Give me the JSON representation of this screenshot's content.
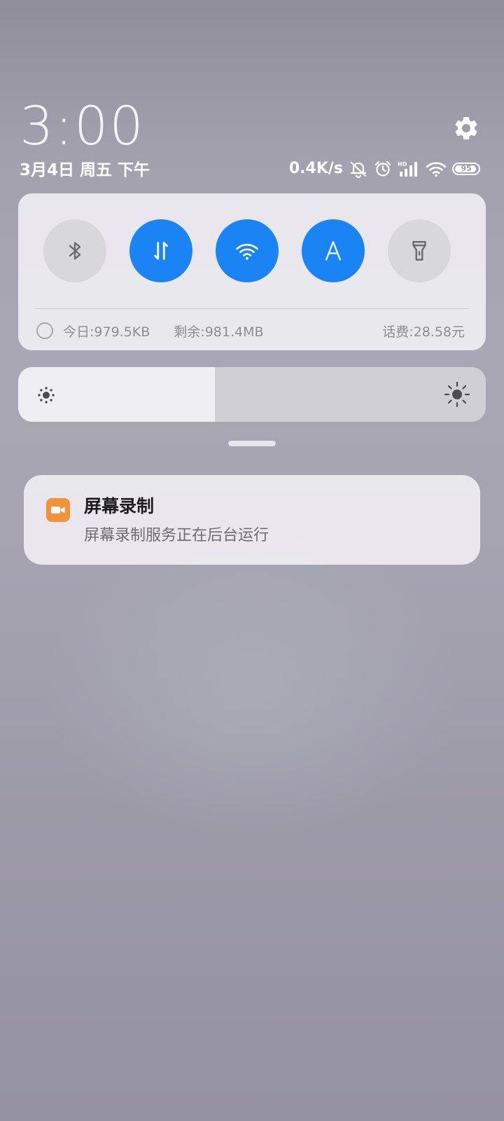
{
  "header": {
    "time": "3:00",
    "date": "3月4日 周五 下午"
  },
  "status_bar": {
    "net_speed": "0.4K/s",
    "icons": [
      "mute-bell-icon",
      "alarm-icon",
      "hd-signal-icon",
      "wifi-icon",
      "battery-icon"
    ],
    "battery_level": "95",
    "battery_percent": 95
  },
  "quick_settings": {
    "toggles": [
      {
        "name": "bluetooth",
        "icon": "bluetooth-icon",
        "state": "off"
      },
      {
        "name": "mobile-data",
        "icon": "mobile-data-icon",
        "state": "on"
      },
      {
        "name": "wifi",
        "icon": "wifi-icon",
        "state": "on"
      },
      {
        "name": "auto-brightness",
        "icon": "auto-brightness-icon",
        "state": "on"
      },
      {
        "name": "flashlight",
        "icon": "flashlight-icon",
        "state": "off"
      }
    ],
    "data_usage": {
      "today": "今日:979.5KB",
      "remaining": "剩余:981.4MB",
      "balance": "话费:28.58元"
    }
  },
  "brightness": {
    "level_percent": 42
  },
  "notification": {
    "app_icon": "video-camera-icon",
    "title": "屏幕录制",
    "text": "屏幕录制服务正在后台运行"
  },
  "colors": {
    "accent": "#1a84f5",
    "notification_icon": "#f3923a"
  }
}
